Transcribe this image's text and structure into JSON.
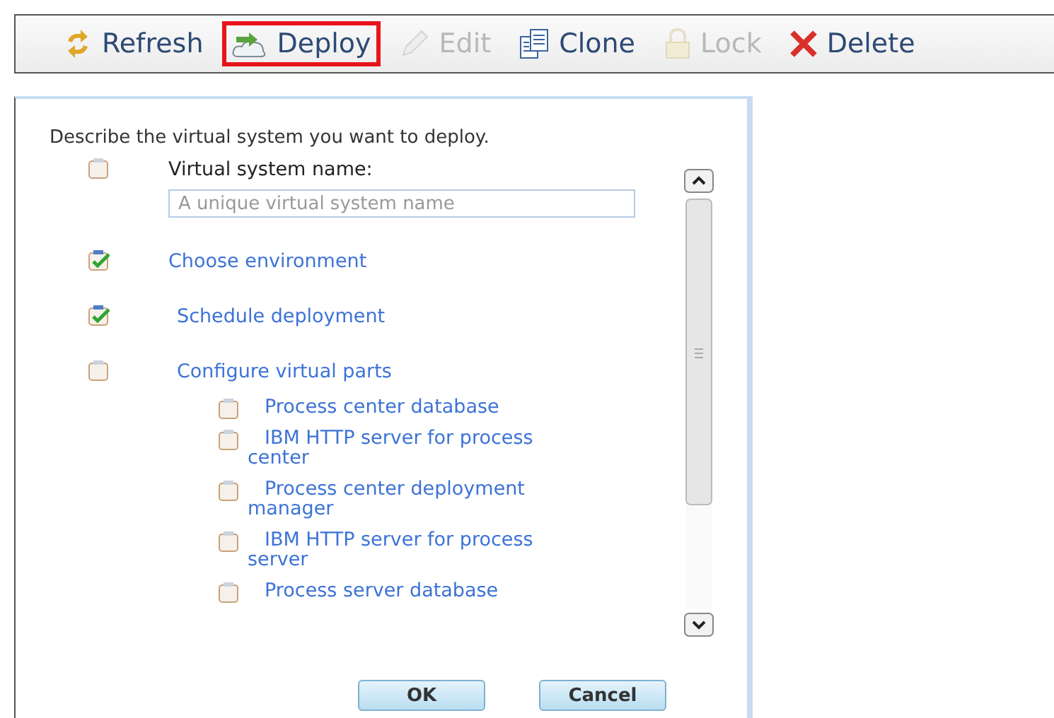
{
  "toolbar": [
    {
      "kind": "refresh",
      "label": "Refresh",
      "disabled": false,
      "selected": false
    },
    {
      "kind": "deploy",
      "label": "Deploy",
      "disabled": false,
      "selected": true
    },
    {
      "kind": "edit",
      "label": "Edit",
      "disabled": true,
      "selected": false
    },
    {
      "kind": "clone",
      "label": "Clone",
      "disabled": false,
      "selected": false
    },
    {
      "kind": "lock",
      "label": "Lock",
      "disabled": true,
      "selected": false
    },
    {
      "kind": "delete",
      "label": "Delete",
      "disabled": false,
      "selected": false
    }
  ],
  "dialog": {
    "intro": "Describe the virtual system you want to deploy.",
    "steps": [
      {
        "kind": "field",
        "label": "Virtual system name:",
        "placeholder": "A unique virtual system name",
        "done": false
      },
      {
        "kind": "link",
        "label": "Choose environment",
        "done": true
      },
      {
        "kind": "link",
        "label": "Schedule deployment",
        "done": true
      },
      {
        "kind": "link",
        "label": "Configure virtual parts",
        "done": false,
        "children": [
          {
            "label": "Process center database",
            "done": false
          },
          {
            "label": "IBM HTTP server for process center",
            "done": false
          },
          {
            "label": "Process center deployment manager",
            "done": false
          },
          {
            "label": "IBM HTTP server for process server",
            "done": false
          },
          {
            "label": "Process server database",
            "done": false
          }
        ]
      }
    ],
    "buttons": [
      "OK",
      "Cancel"
    ]
  }
}
